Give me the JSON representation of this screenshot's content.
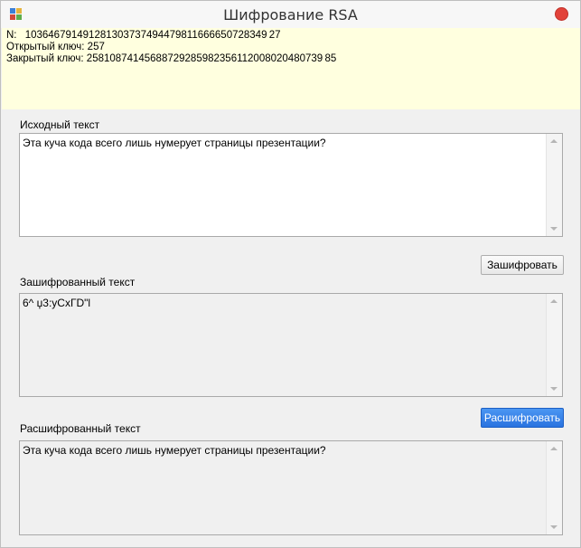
{
  "window": {
    "title": "Шифрование RSA"
  },
  "keys": {
    "n_label": "N:",
    "n_value": "103646791491281303737494479811666650728349 27",
    "public_key": "Открытый ключ: 257",
    "private_key": "Закрытый ключ: 25810874145688729285982356112008020480739 85"
  },
  "source": {
    "label": "Исходный текст",
    "text": "Эта куча кода всего лишь нумерует страницы презентации?"
  },
  "encrypted": {
    "label": "Зашифрованный текст",
    "text": "6^ џ3:уСхГD\"l"
  },
  "decrypted": {
    "label": "Расшифрованный текст",
    "text": "Эта куча кода всего лишь нумерует страницы презентации?"
  },
  "buttons": {
    "encrypt": "Зашифровать",
    "decrypt": "Расшифровать"
  },
  "colors": {
    "info_background": "#ffffdf",
    "close_button": "#e2433a",
    "default_button": "#2a73e0"
  }
}
